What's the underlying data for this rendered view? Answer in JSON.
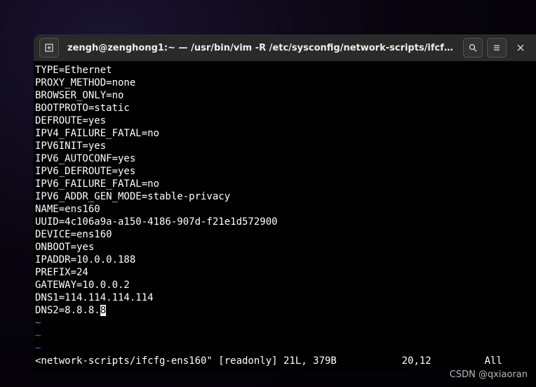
{
  "titlebar": {
    "title": "zengh@zenghong1:~ — /usr/bin/vim -R /etc/sysconfig/network-scripts/ifcf…"
  },
  "file_lines": [
    "TYPE=Ethernet",
    "PROXY_METHOD=none",
    "BROWSER_ONLY=no",
    "BOOTPROTO=static",
    "DEFROUTE=yes",
    "IPV4_FAILURE_FATAL=no",
    "IPV6INIT=yes",
    "IPV6_AUTOCONF=yes",
    "IPV6_DEFROUTE=yes",
    "IPV6_FAILURE_FATAL=no",
    "IPV6_ADDR_GEN_MODE=stable-privacy",
    "NAME=ens160",
    "UUID=4c106a9a-a150-4186-907d-f21e1d572900",
    "DEVICE=ens160",
    "ONBOOT=yes",
    "IPADDR=10.0.0.188",
    "PREFIX=24",
    "GATEWAY=10.0.0.2",
    "DNS1=114.114.114.114"
  ],
  "cursor_line": {
    "before": "DNS2=8.8.8.",
    "at": "8"
  },
  "tilde": "~",
  "status": {
    "left": "<network-scripts/ifcfg-ens160\" [readonly] 21L, 379B",
    "pos": "20,12",
    "right": "All"
  },
  "watermark": "CSDN @qxiaoran"
}
